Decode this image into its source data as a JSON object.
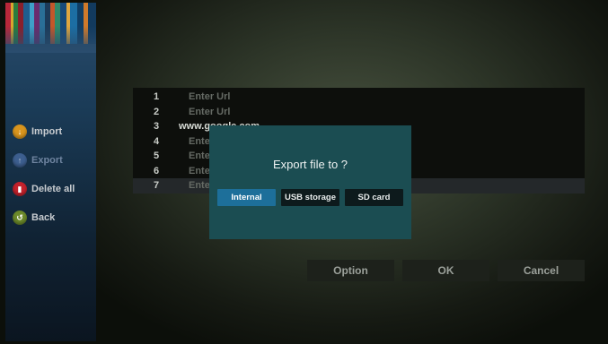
{
  "sidebar": {
    "items": [
      {
        "label": "Import",
        "icon": "import-icon",
        "enabled": true
      },
      {
        "label": "Export",
        "icon": "export-icon",
        "enabled": false
      },
      {
        "label": "Delete all",
        "icon": "delete-icon",
        "enabled": true
      },
      {
        "label": "Back",
        "icon": "back-icon",
        "enabled": true
      }
    ]
  },
  "url_list": {
    "rows": [
      {
        "num": "1",
        "text": "Enter Url"
      },
      {
        "num": "2",
        "text": "Enter Url"
      },
      {
        "num": "3",
        "text": "www.google.com"
      },
      {
        "num": "4",
        "text": "Ente"
      },
      {
        "num": "5",
        "text": "Ente"
      },
      {
        "num": "6",
        "text": "Ente"
      },
      {
        "num": "7",
        "text": "Ente"
      }
    ],
    "selected_row": "7"
  },
  "buttons": {
    "option": "Option",
    "ok": "OK",
    "cancel": "Cancel"
  },
  "dialog": {
    "title": "Export file to ?",
    "options": [
      "Internal",
      "USB storage",
      "SD card"
    ],
    "selected": "Internal"
  },
  "colors": {
    "dialog_bg": "#1b4d52",
    "selected_option": "#1d6f9a",
    "sidebar": "#1b3c58"
  }
}
